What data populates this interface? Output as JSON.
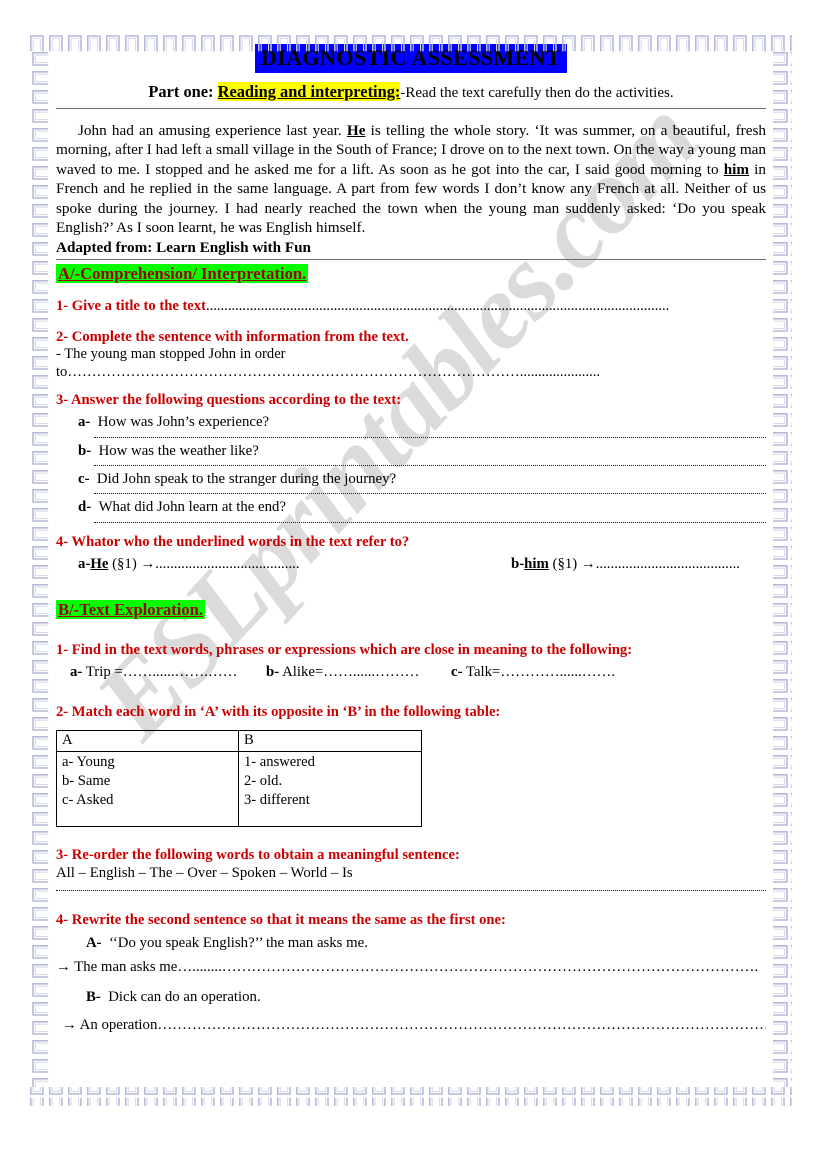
{
  "document": {
    "title": "DIAGNOSTIC ASSESSMENT",
    "title_highlight_color": "#0000FF",
    "section_highlight_color": "#00FF00",
    "part_highlight_color": "#FFFF00",
    "question_color": "#CC0000",
    "watermark": "ESLprintables.com"
  },
  "part_one": {
    "label": "Part one:",
    "topic": "Reading and interpreting:",
    "instruction": "-Read the text carefully then do the activities."
  },
  "passage": {
    "text": "John had an amusing experience last year. He is telling the whole story. ‘It was summer, on a beautiful, fresh morning, after I had left a small village in the South of France; I drove on to the next town. On the way a young man waved to me. I stopped and he asked me for a lift. As soon as he got into the car, I said good morning to him in French and he replied in the same language. A part from few words I don’t know any French at all. Neither of us spoke during the journey. I had nearly reached the town when the young man suddenly asked: ‘Do you speak English?’ As I soon learnt, he was English himself.",
    "seg1": "John had an amusing experience last year. ",
    "underlined1": "He",
    "seg2": " is telling the whole story. ‘It was summer, on a beautiful, fresh morning, after I had left a small village in the South of France; I drove on to the next town. On the way a young man waved to me. I stopped and he asked me for a lift. As soon as he got into the car, I said good morning to ",
    "underlined2": "him",
    "seg3": " in French and he replied in the same language. A part from few words I don’t know any French at all. Neither of us spoke during the journey. I had nearly reached the town when the young man suddenly asked: ‘Do you speak English?’ As I soon learnt, he was English himself.",
    "source": "Adapted from: Learn English with Fun"
  },
  "section_a": {
    "heading": "A/-Comprehension/ Interpretation.",
    "q1": {
      "prompt": "1- Give a title to the text",
      "dots": "..............................................................................................................................."
    },
    "q2": {
      "prompt": "2- Complete the sentence with information from the text.",
      "stem": "- The young man stopped John in order to",
      "dots": "…………………………………………………………………………………......................"
    },
    "q3": {
      "prompt": "3- Answer the following questions according to the text:",
      "items": [
        {
          "letter": "a-",
          "text": "How was John’s experience?"
        },
        {
          "letter": "b-",
          "text": "How was the weather like?"
        },
        {
          "letter": "c-",
          "text": "Did John speak to the stranger during the journey?"
        },
        {
          "letter": "d-",
          "text": "What did John learn at the end?"
        }
      ]
    },
    "q4": {
      "prompt": "4- Whator who the underlined words in the text refer to?",
      "ref_a_letter": "a-",
      "ref_a_word": "He",
      "ref_a_para": "(§1)",
      "ref_a_arrow": "→",
      "ref_a_dots": ".......................................",
      "ref_b_letter": "b-",
      "ref_b_word": "him",
      "ref_b_para": "(§1)",
      "ref_b_arrow": "→",
      "ref_b_dots": "......................................."
    }
  },
  "section_b": {
    "heading": "B/-Text Exploration.",
    "q1": {
      "prompt": "1- Find in the text words, phrases or expressions which are close in meaning to the following:",
      "items": [
        {
          "letter": "a-",
          "word": "Trip =",
          "dots": "……......…….……"
        },
        {
          "letter": "b-",
          "word": "Alike=",
          "dots": "……......………"
        },
        {
          "letter": "c-",
          "word": "Talk=",
          "dots": "…………......……."
        }
      ]
    },
    "q2": {
      "prompt": "2- Match each word in ‘A’ with its opposite in ‘B’ in the following table:",
      "table": {
        "headers": [
          "A",
          "B"
        ],
        "column_a": [
          "a- Young",
          "b- Same",
          "c- Asked"
        ],
        "column_b": [
          "1- answered",
          "2- old.",
          "3- different"
        ]
      }
    },
    "q3": {
      "prompt": "3- Re-order the following words to obtain a meaningful sentence:",
      "words": "All – English – The – Over – Spoken – World – Is"
    },
    "q4": {
      "prompt": "4- Rewrite the second sentence so that it means the same as the first one:",
      "a_letter": "A-",
      "a_text": "‘‘Do you speak English?’’ the man asks me.",
      "a_answer_arrow": "→ The man asks me",
      "a_answer_dots": "…........……………………………………………………………………………………………….",
      "b_letter": "B-",
      "b_text": "Dick can do an operation.",
      "b_answer_arrow": "→ An operation",
      "b_answer_dots": "……………………………………………………………………………………………………………………………"
    }
  }
}
